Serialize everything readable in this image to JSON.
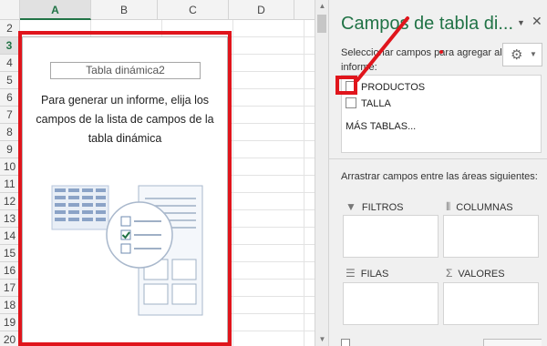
{
  "sheet": {
    "columns": [
      "A",
      "B",
      "C",
      "D"
    ],
    "selected_column": "A",
    "rows": [
      "2",
      "3",
      "4",
      "5",
      "6",
      "7",
      "8",
      "9",
      "10",
      "11",
      "12",
      "13",
      "14",
      "15",
      "16",
      "17",
      "18",
      "19",
      "20"
    ],
    "selected_row": "3"
  },
  "pivot": {
    "name": "Tabla dinámica2",
    "message": "Para generar un informe, elija los campos de la lista de campos de la tabla dinámica"
  },
  "pane": {
    "title": "Campos de tabla di...",
    "subtitle": "Seleccionar campos para agregar al informe:",
    "fields": [
      {
        "label": "PRODUCTOS",
        "checked": false
      },
      {
        "label": "TALLA",
        "checked": false
      }
    ],
    "more_tables": "MÁS TABLAS...",
    "drag_hint": "Arrastrar campos entre las áreas siguientes:",
    "areas": {
      "filters": "FILTROS",
      "columns": "COLUMNAS",
      "rows": "FILAS",
      "values": "VALORES"
    }
  },
  "colors": {
    "accent": "#217346",
    "annotation_red": "#e0151c"
  },
  "icons": {
    "settings": "gear-icon",
    "close": "close-icon",
    "dropdown": "chevron-down-icon",
    "filter": "filter-icon",
    "columns": "columns-icon",
    "rows": "rows-icon",
    "values": "sigma-icon"
  }
}
